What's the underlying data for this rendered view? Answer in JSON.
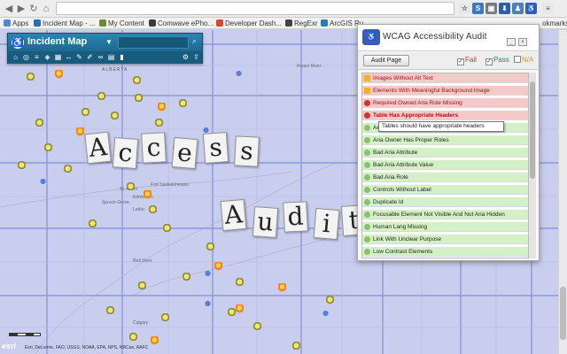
{
  "browser": {
    "bookmarks": [
      {
        "label": "Apps",
        "color": "#4a8be0"
      },
      {
        "label": "Incident Map - ...",
        "color": "#2b6fb0"
      },
      {
        "label": "My Content",
        "color": "#6a8a34"
      },
      {
        "label": "Comwave ePho...",
        "color": "#3a3a3a"
      },
      {
        "label": "Developer Dash...",
        "color": "#d44a2a"
      },
      {
        "label": "RegExr",
        "color": "#444444"
      },
      {
        "label": "ArcGIS Ru",
        "color": "#2c7bb6"
      }
    ],
    "bookmarks_trailing": "okmarks"
  },
  "incident_map": {
    "title": "Incident Map"
  },
  "overlay": {
    "line1": "Access",
    "line2": "Audit"
  },
  "wcag": {
    "title": "WCAG Accessibility Audit",
    "audit_button": "Audit Page",
    "filters": {
      "fail": "Fail",
      "pass": "Pass",
      "na": "N/A"
    },
    "tooltip": "Tables should have appropriate headers",
    "items": [
      {
        "label": "Images Without Alt Text",
        "status": "fail",
        "icon": "warning-icon"
      },
      {
        "label": "Elements With Meaningful Background Image",
        "status": "fail",
        "icon": "warning-icon"
      },
      {
        "label": "Required Owned Aria Role Missing",
        "status": "fail",
        "icon": "error-icon"
      },
      {
        "label": "Table Has Appropriate Headers",
        "status": "fail",
        "icon": "error-icon",
        "emphasis": true
      },
      {
        "label": "Aria On Reserved Element",
        "status": "pass",
        "icon": "pass-icon"
      },
      {
        "label": "Aria Owner Has Proper Roles",
        "status": "pass",
        "icon": "pass-icon"
      },
      {
        "label": "Bad Aria Attribute",
        "status": "pass",
        "icon": "pass-icon"
      },
      {
        "label": "Bad Aria Attribute Value",
        "status": "pass",
        "icon": "pass-icon"
      },
      {
        "label": "Bad Aria Role",
        "status": "pass",
        "icon": "pass-icon"
      },
      {
        "label": "Controls Without Label",
        "status": "pass",
        "icon": "pass-icon"
      },
      {
        "label": "Duplicate Id",
        "status": "pass",
        "icon": "pass-icon"
      },
      {
        "label": "Focusable Element Not Visible And Not Aria Hidden",
        "status": "pass",
        "icon": "pass-icon"
      },
      {
        "label": "Human Lang Missing",
        "status": "pass",
        "icon": "pass-icon"
      },
      {
        "label": "Link With Unclear Purpose",
        "status": "pass",
        "icon": "pass-icon"
      },
      {
        "label": "Low Contrast Elements",
        "status": "pass",
        "icon": "pass-icon"
      }
    ]
  },
  "map": {
    "province": "ALBERTA",
    "cities": [
      "Fort Saskatchewan",
      "St. Albert",
      "Edmonton",
      "Spruce Grove",
      "Leduc",
      "Red Deer",
      "Calgary",
      "Peace River"
    ],
    "attribution": "Esri, DeLorme, FAO, USGS, NOAA, EPA, NPS, NRCan, AAFC",
    "esri": "esri"
  }
}
